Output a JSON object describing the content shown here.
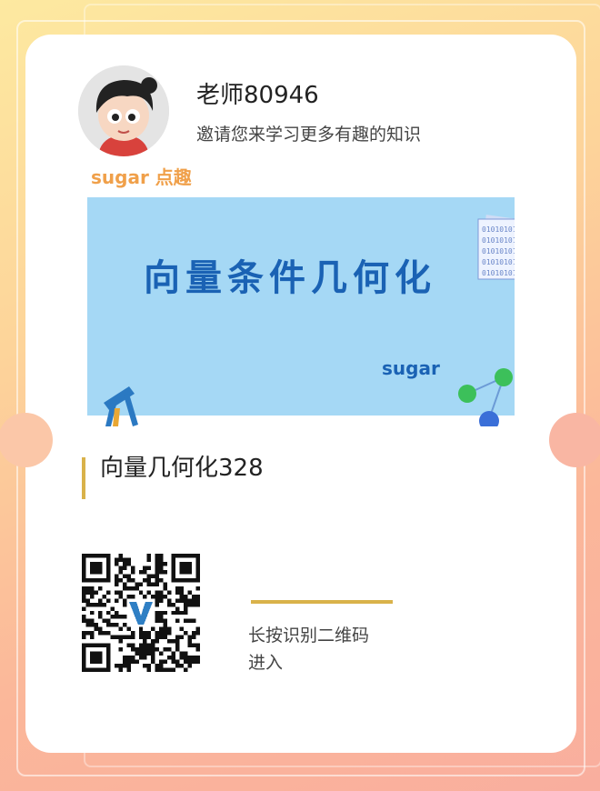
{
  "header": {
    "teacher_name": "老师80946",
    "invite_text": "邀请您来学习更多有趣的知识"
  },
  "cover": {
    "top_brand": "sugar 点趣",
    "title": "向量条件几何化",
    "brand": "sugar"
  },
  "course": {
    "title": "向量几何化328"
  },
  "qr_code": {
    "instruction_line1": "长按识别二维码",
    "instruction_line2": "进入"
  },
  "colors": {
    "accent": "#d9b24a",
    "cover_background": "#a5d8f5",
    "cover_title": "#1a62b4",
    "brand_orange": "#f0a04a"
  }
}
